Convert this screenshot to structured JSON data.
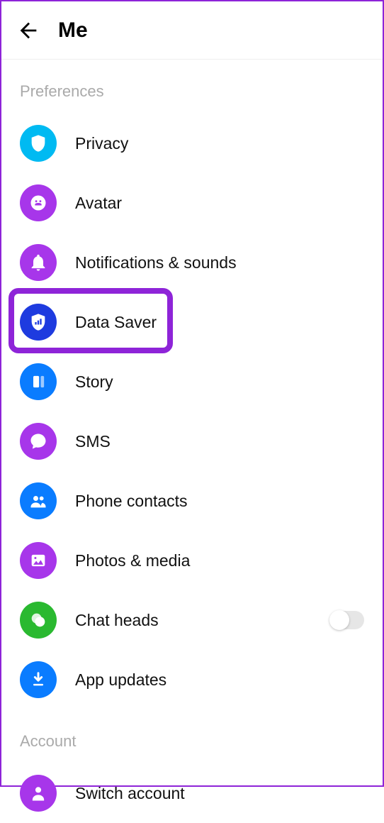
{
  "header": {
    "title": "Me"
  },
  "sections": {
    "preferences": {
      "label": "Preferences"
    },
    "account": {
      "label": "Account"
    }
  },
  "items": {
    "privacy": {
      "label": "Privacy"
    },
    "avatar": {
      "label": "Avatar"
    },
    "notifications": {
      "label": "Notifications & sounds"
    },
    "data_saver": {
      "label": "Data Saver"
    },
    "story": {
      "label": "Story"
    },
    "sms": {
      "label": "SMS"
    },
    "contacts": {
      "label": "Phone contacts"
    },
    "photos": {
      "label": "Photos & media"
    },
    "chat_heads": {
      "label": "Chat heads",
      "toggle": false
    },
    "updates": {
      "label": "App updates"
    },
    "switch": {
      "label": "Switch account"
    }
  },
  "colors": {
    "cyan": "#00baf2",
    "purple": "#a736ea",
    "blue": "#0a7cff",
    "royal": "#1e3bdf",
    "green": "#2ab930",
    "highlight": "#8e24d8"
  }
}
